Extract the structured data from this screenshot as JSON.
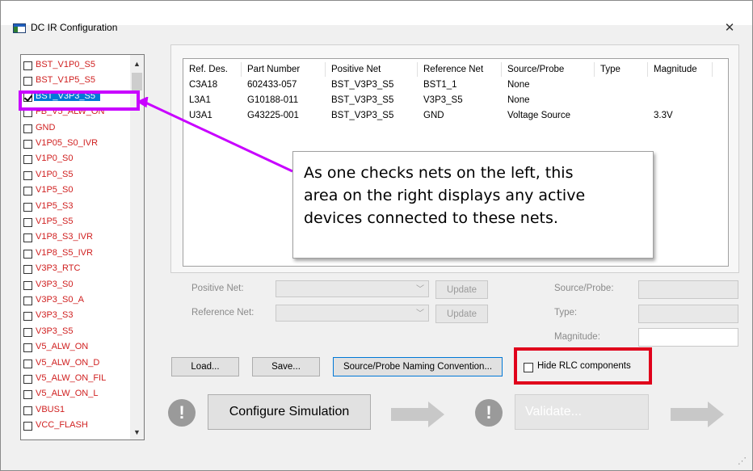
{
  "window": {
    "title": "DC IR Configuration",
    "close_glyph": "✕"
  },
  "nets": [
    {
      "label": "BST_V1P0_S5",
      "checked": false
    },
    {
      "label": "BST_V1P5_S5",
      "checked": false
    },
    {
      "label": "BST_V3P3_S5",
      "checked": true,
      "selected": true
    },
    {
      "label": "FB_V5_ALW_ON",
      "checked": false
    },
    {
      "label": "GND",
      "checked": false
    },
    {
      "label": "V1P05_S0_IVR",
      "checked": false
    },
    {
      "label": "V1P0_S0",
      "checked": false
    },
    {
      "label": "V1P0_S5",
      "checked": false
    },
    {
      "label": "V1P5_S0",
      "checked": false
    },
    {
      "label": "V1P5_S3",
      "checked": false
    },
    {
      "label": "V1P5_S5",
      "checked": false
    },
    {
      "label": "V1P8_S3_IVR",
      "checked": false
    },
    {
      "label": "V1P8_S5_IVR",
      "checked": false
    },
    {
      "label": "V3P3_RTC",
      "checked": false
    },
    {
      "label": "V3P3_S0",
      "checked": false
    },
    {
      "label": "V3P3_S0_A",
      "checked": false
    },
    {
      "label": "V3P3_S3",
      "checked": false
    },
    {
      "label": "V3P3_S5",
      "checked": false
    },
    {
      "label": "V5_ALW_ON",
      "checked": false
    },
    {
      "label": "V5_ALW_ON_D",
      "checked": false
    },
    {
      "label": "V5_ALW_ON_FIL",
      "checked": false
    },
    {
      "label": "V5_ALW_ON_L",
      "checked": false
    },
    {
      "label": "VBUS1",
      "checked": false
    },
    {
      "label": "VCC_FLASH",
      "checked": false
    }
  ],
  "table": {
    "headers": [
      "Ref. Des.",
      "Part Number",
      "Positive Net",
      "Reference Net",
      "Source/Probe",
      "Type",
      "Magnitude"
    ],
    "rows": [
      [
        "C3A18",
        "602433-057",
        "BST_V3P3_S5",
        "BST1_1",
        "None",
        "",
        ""
      ],
      [
        "L3A1",
        "G10188-011",
        "BST_V3P3_S5",
        "V3P3_S5",
        "None",
        "",
        ""
      ],
      [
        "U3A1",
        "G43225-001",
        "BST_V3P3_S5",
        "GND",
        "Voltage Source",
        "",
        "3.3V"
      ]
    ]
  },
  "form": {
    "positive_net_label": "Positive Net:",
    "reference_net_label": "Reference Net:",
    "update_label": "Update",
    "source_probe_label": "Source/Probe:",
    "type_label": "Type:",
    "magnitude_label": "Magnitude:"
  },
  "buttons": {
    "load": "Load...",
    "save": "Save...",
    "naming": "Source/Probe Naming Convention...",
    "hide_rlc": "Hide RLC components",
    "configure": "Configure Simulation",
    "validate": "Validate..."
  },
  "icons": {
    "warning": "!",
    "arrow": "arrow-right-icon"
  },
  "annotation": {
    "callout_text": "As one checks nets on the left, this area on the right displays any active devices connected to these nets.",
    "callout_lines": [
      "As one checks nets on the left, this",
      "area on the right displays any active",
      "devices connected to these nets."
    ],
    "highlight_color_magenta": "#c800ff",
    "highlight_color_red": "#e0001b"
  }
}
